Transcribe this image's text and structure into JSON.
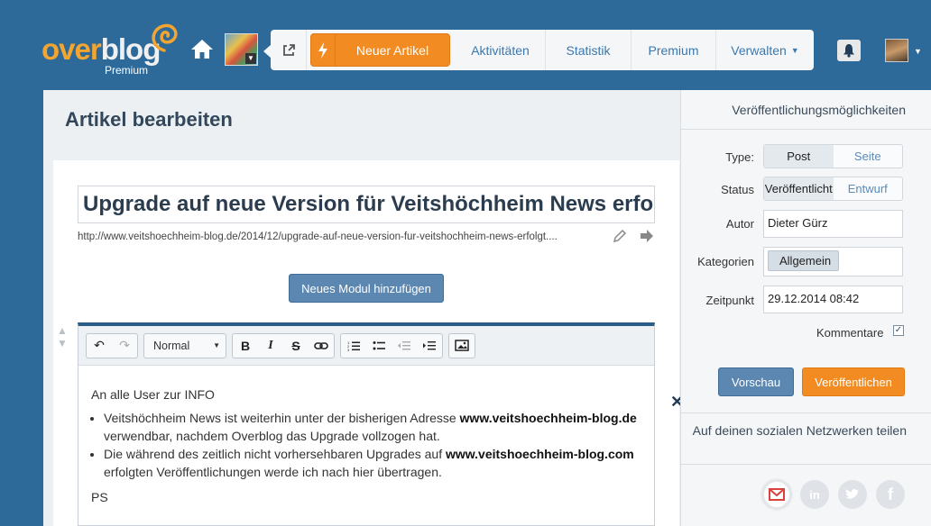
{
  "app": {
    "logo_overblog_over": "over",
    "logo_overblog_blog": "blog",
    "logo_sub": "Premium"
  },
  "nav": {
    "new_article": "Neuer Artikel",
    "items": [
      "Aktivitäten",
      "Statistik",
      "Premium",
      "Verwalten"
    ]
  },
  "main": {
    "page_title": "Artikel bearbeiten",
    "article_title": "Upgrade auf neue Version für Veitshöchheim News erfolgt",
    "url": "http://www.veitshoechheim-blog.de/2014/12/upgrade-auf-neue-version-fur-veitshochheim-news-erfolgt....",
    "add_module": "Neues Modul hinzufügen"
  },
  "editor": {
    "format_select": "Normal",
    "intro": "An alle User zur INFO",
    "bullet1_a": "Veitshöchheim News ist weiterhin unter der bisherigen Adresse ",
    "bullet1_bold": "www.veitshoechheim-blog.de",
    "bullet1_b": " verwendbar, nachdem Overblog das Upgrade vollzogen hat.",
    "bullet2_a": "Die während des zeitlich nicht vorhersehbaren Upgrades auf ",
    "bullet2_bold": "www.veitshoechheim-blog.com",
    "bullet2_b": " erfolgten Veröffentlichungen werde ich nach hier übertragen.",
    "ps": "PS"
  },
  "sidebar": {
    "header": "Veröffentlichungsmöglichkeiten",
    "type_label": "Type:",
    "type_options": [
      "Post",
      "Seite"
    ],
    "type_selected": "Post",
    "status_label": "Status",
    "status_options": [
      "Veröffentlicht",
      "Entwurf"
    ],
    "status_selected": "Veröffentlicht",
    "author_label": "Autor",
    "author_value": "Dieter Gürz",
    "category_label": "Kategorien",
    "category_value": "Allgemein",
    "time_label": "Zeitpunkt",
    "time_value": "29.12.2014 08:42",
    "comments_label": "Kommentare",
    "comments_checked": true,
    "preview_button": "Vorschau",
    "publish_button": "Veröffentlichen",
    "social_header": "Auf deinen sozialen Netzwerken teilen"
  },
  "colors": {
    "background": "#2d6a9a",
    "accent_orange": "#f28c22",
    "accent_blue": "#5b87b1",
    "gmail_red": "#d9453c"
  }
}
